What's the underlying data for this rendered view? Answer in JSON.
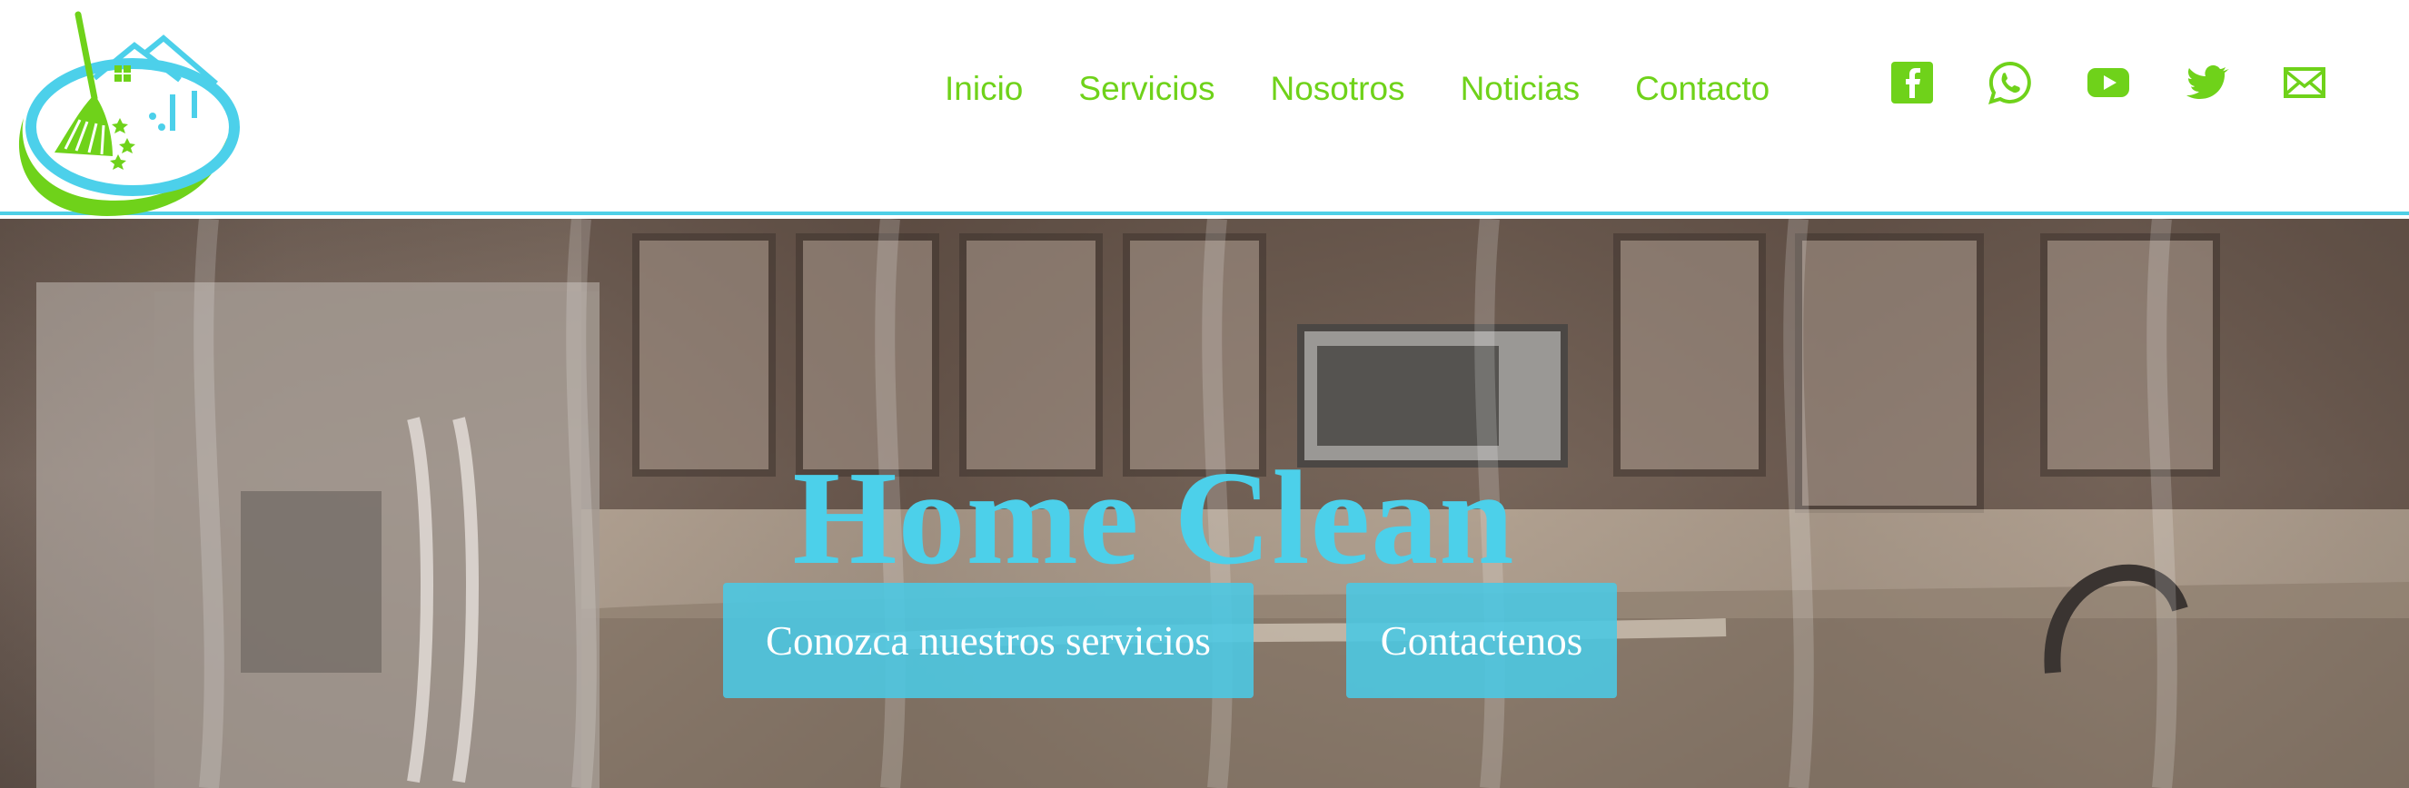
{
  "header": {
    "logo_icon": "broom-house-logo-icon",
    "nav": [
      {
        "label": "Inicio"
      },
      {
        "label": "Servicios"
      },
      {
        "label": "Nosotros"
      },
      {
        "label": "Noticias"
      },
      {
        "label": "Contacto"
      }
    ],
    "social": [
      {
        "icon": "facebook-icon"
      },
      {
        "icon": "whatsapp-icon"
      },
      {
        "icon": "youtube-icon"
      },
      {
        "icon": "twitter-icon"
      },
      {
        "icon": "mail-icon"
      }
    ]
  },
  "hero": {
    "title": "Home Clean",
    "buttons": {
      "services_label": "Conozca nuestros servicios",
      "contact_label": "Contactenos"
    },
    "background": "kitchen-photo"
  },
  "colors": {
    "brand_green": "#6fd21a",
    "brand_cyan": "#4cd0ea",
    "button_bg": "#4dc8e2",
    "header_border": "#4fcfe6"
  }
}
